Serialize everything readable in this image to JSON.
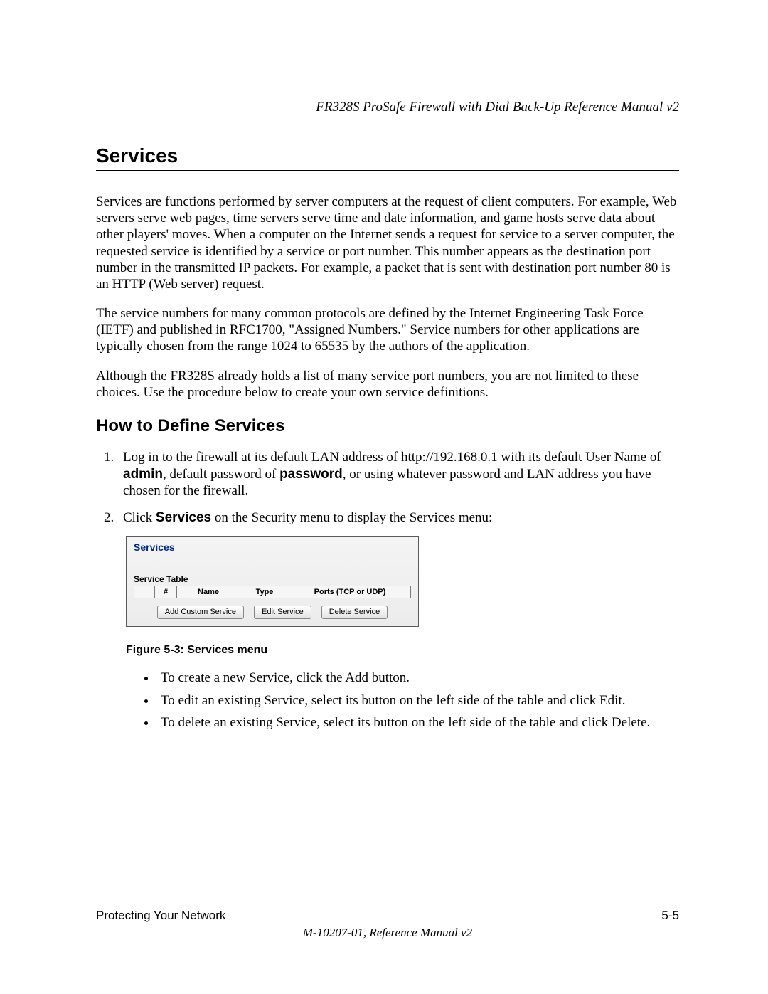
{
  "header": {
    "running_title": "FR328S ProSafe Firewall with Dial Back-Up Reference Manual v2"
  },
  "section": {
    "title": "Services",
    "para1": "Services are functions performed by server computers at the request of client computers. For example, Web servers serve web pages, time servers serve time and date information, and game hosts serve data about other players' moves. When a computer on the Internet sends a request for service to a server computer, the requested service is identified by a service or port number. This number appears as the destination port number in the transmitted IP packets. For example, a packet that is sent with destination port number 80 is an HTTP (Web server) request.",
    "para2": "The service numbers for many common protocols are defined by the Internet Engineering Task Force (IETF) and published in RFC1700, \"Assigned Numbers.\" Service numbers for other applications are typically chosen from the range 1024 to 65535 by the authors of the application.",
    "para3": "Although the FR328S already holds a list of many service port numbers, you are not limited to these choices. Use the procedure below to create your own service definitions."
  },
  "subsection": {
    "title": "How to Define Services",
    "step1_a": "Log in to the firewall at its default LAN address of http://192.168.0.1 with its default User Name of ",
    "step1_bold1": "admin",
    "step1_b": ", default password of ",
    "step1_bold2": "password",
    "step1_c": ", or using whatever password and LAN address you have chosen for the firewall.",
    "step2_a": "Click ",
    "step2_bold": "Services",
    "step2_b": " on the Security menu to display the Services menu:"
  },
  "figure": {
    "panel_title": "Services",
    "table_label": "Service Table",
    "col_num": "#",
    "col_name": "Name",
    "col_type": "Type",
    "col_ports": "Ports (TCP or UDP)",
    "btn_add": "Add Custom Service",
    "btn_edit": "Edit Service",
    "btn_delete": "Delete Service",
    "caption": "Figure 5-3:  Services menu"
  },
  "bullets": {
    "b1": "To create a new Service, click the Add button.",
    "b2": "To edit an existing Service, select its button on the left side of the table and click Edit.",
    "b3": "To delete an existing Service, select its button on the left side of the table and click Delete."
  },
  "footer": {
    "left": "Protecting Your Network",
    "right": "5-5",
    "doc": "M-10207-01, Reference Manual v2"
  }
}
